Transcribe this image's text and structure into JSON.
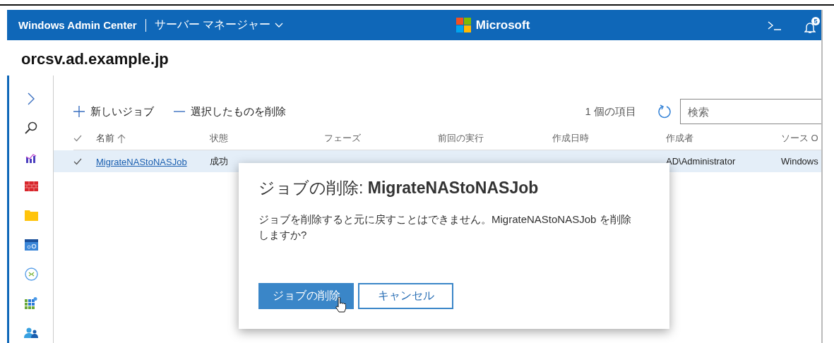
{
  "header": {
    "brand": "Windows Admin Center",
    "tool": "サーバー マネージャー",
    "logo": "Microsoft",
    "notification_count": "5"
  },
  "server": "orcsv.ad.example.jp",
  "toolbar": {
    "actions": [
      {
        "kind": "add",
        "label": "新しいジョブ"
      },
      {
        "kind": "remove",
        "label": "選択したものを削除"
      }
    ],
    "item_count": "1 個の項目",
    "search": {
      "placeholder": "検索"
    }
  },
  "table": {
    "columns": [
      {
        "label": "名前",
        "sorted": true
      },
      {
        "label": "状態",
        "sorted": false
      },
      {
        "label": "フェーズ",
        "sorted": false
      },
      {
        "label": "前回の実行",
        "sorted": false
      },
      {
        "label": "作成日時",
        "sorted": false
      },
      {
        "label": "作成者",
        "sorted": false
      },
      {
        "label": "ソース O",
        "sorted": false
      }
    ],
    "rows": [
      {
        "selected": true,
        "cells": [
          "MigrateNAStoNASJob",
          "成功",
          null,
          null,
          null,
          "AD\\Administrator",
          "Windows"
        ]
      }
    ]
  },
  "dialog": {
    "title": "ジョブの削除: **MigrateNAStoNASJob**",
    "message": "ジョブを削除すると元に戻すことはできません。MigrateNAStoNASJob を削除しますか?",
    "buttons": [
      {
        "kind": "primary",
        "label": "ジョブの削除"
      },
      {
        "kind": "secondary",
        "label": "キャンセル"
      }
    ]
  }
}
